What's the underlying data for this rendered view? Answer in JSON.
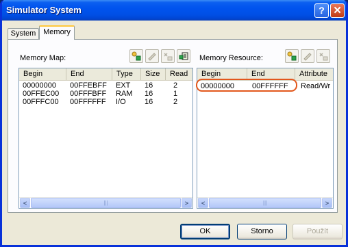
{
  "window": {
    "title": "Simulator System"
  },
  "tabs": [
    {
      "label": "System"
    },
    {
      "label": "Memory"
    }
  ],
  "memory_map": {
    "label": "Memory Map:",
    "columns": [
      "Begin",
      "End",
      "Type",
      "Size",
      "Read"
    ],
    "rows": [
      [
        "00000000",
        "00FFEBFF",
        "EXT",
        "16",
        "2"
      ],
      [
        "00FFEC00",
        "00FFFBFF",
        "RAM",
        "16",
        "1"
      ],
      [
        "00FFFC00",
        "00FFFFFF",
        "I/O",
        "16",
        "2"
      ]
    ],
    "toolbar_icons": [
      "add-icon",
      "edit-icon",
      "delete-icon",
      "properties-icon"
    ]
  },
  "memory_resource": {
    "label": "Memory Resource:",
    "columns": [
      "Begin",
      "End",
      "Attribute"
    ],
    "rows": [
      [
        "00000000",
        "00FFFFFF",
        "Read/Wr"
      ]
    ],
    "toolbar_icons": [
      "add-icon",
      "edit-icon",
      "delete-icon"
    ]
  },
  "buttons": {
    "ok": "OK",
    "cancel": "Storno",
    "apply": "Použít"
  },
  "colors": {
    "title_bar": "#0053ee",
    "highlight_ring": "#e2571c"
  }
}
